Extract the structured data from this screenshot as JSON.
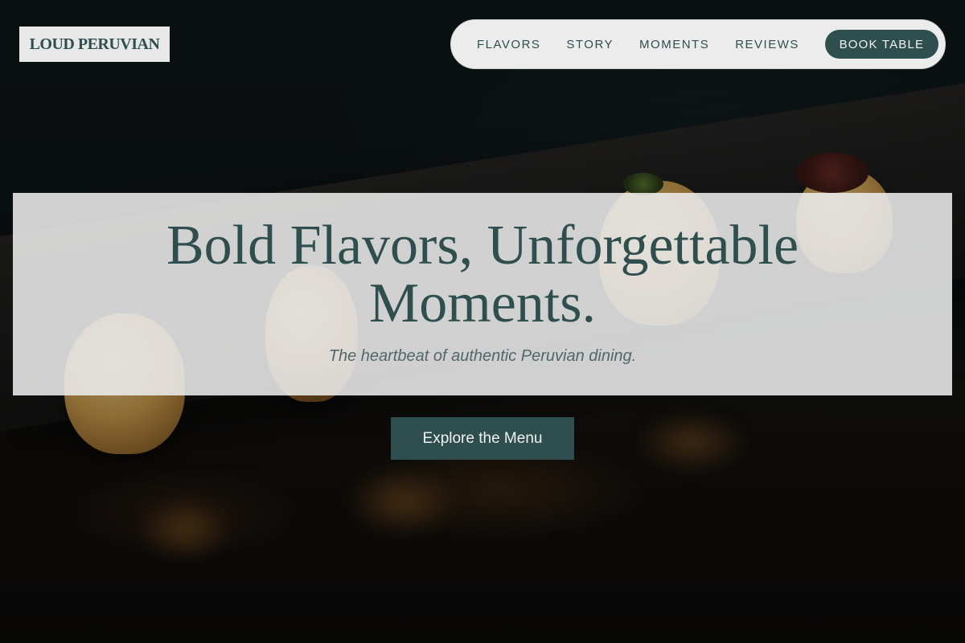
{
  "brand": {
    "name": "LOUD PERUVIAN"
  },
  "nav": {
    "links": [
      "FLAVORS",
      "STORY",
      "MOMENTS",
      "REVIEWS"
    ],
    "cta_label": "BOOK TABLE"
  },
  "hero": {
    "headline": "Bold Flavors, Unforgettable Moments.",
    "tagline": "The heartbeat of authentic Peruvian dining.",
    "cta_label": "Explore the Menu",
    "background_image": "dark plated Peruvian dumplings on slate"
  },
  "colors": {
    "primary": "#2f4f4f",
    "panel": "#ececec",
    "text_light": "#f0f0f0"
  }
}
